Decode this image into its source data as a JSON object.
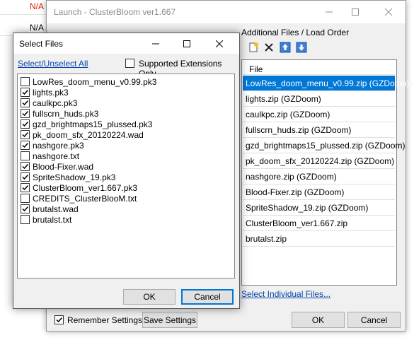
{
  "background": {
    "rows": [
      {
        "text": "N/A",
        "red": true
      },
      {
        "text": "N/A",
        "red": false
      },
      {
        "text": "N/A",
        "red": true
      }
    ]
  },
  "launch": {
    "title": "Launch - ClusterBloom ver1.667",
    "additional_label": "Additional Files / Load Order",
    "list_header": "File",
    "load_order": [
      "LowRes_doom_menu_v0.99.zip (GZDoom)",
      "lights.zip (GZDoom)",
      "caulkpc.zip (GZDoom)",
      "fullscrn_huds.zip (GZDoom)",
      "gzd_brightmaps15_plussed.zip (GZDoom)",
      "pk_doom_sfx_20120224.zip (GZDoom)",
      "nashgore.zip (GZDoom)",
      "Blood-Fixer.zip (GZDoom)",
      "SpriteShadow_19.zip (GZDoom)",
      "ClusterBloom_ver1.667.zip",
      "brutalst.zip"
    ],
    "select_individual": "Select Individual Files...",
    "remember_settings": "Remember Settings",
    "save_settings": "Save Settings",
    "ok": "OK",
    "cancel": "Cancel"
  },
  "select_files": {
    "title": "Select Files",
    "select_unselect": "Select/Unselect All",
    "supported_ext": "Supported Extensions Only",
    "files": [
      {
        "name": "LowRes_doom_menu_v0.99.pk3",
        "checked": false
      },
      {
        "name": "lights.pk3",
        "checked": true
      },
      {
        "name": "caulkpc.pk3",
        "checked": true
      },
      {
        "name": "fullscrn_huds.pk3",
        "checked": true
      },
      {
        "name": "gzd_brightmaps15_plussed.pk3",
        "checked": true
      },
      {
        "name": "pk_doom_sfx_20120224.wad",
        "checked": true
      },
      {
        "name": "nashgore.pk3",
        "checked": true
      },
      {
        "name": "nashgore.txt",
        "checked": false
      },
      {
        "name": "Blood-Fixer.wad",
        "checked": true
      },
      {
        "name": "SpriteShadow_19.pk3",
        "checked": true
      },
      {
        "name": "ClusterBloom_ver1.667.pk3",
        "checked": true
      },
      {
        "name": "CREDITS_ClusterBlooM.txt",
        "checked": false
      },
      {
        "name": "brutalst.wad",
        "checked": true
      },
      {
        "name": "brutalst.txt",
        "checked": false
      }
    ],
    "ok": "OK",
    "cancel": "Cancel"
  },
  "colors": {
    "selection": "#0078d7",
    "link": "#0645ad",
    "na_red": "#e51400"
  }
}
